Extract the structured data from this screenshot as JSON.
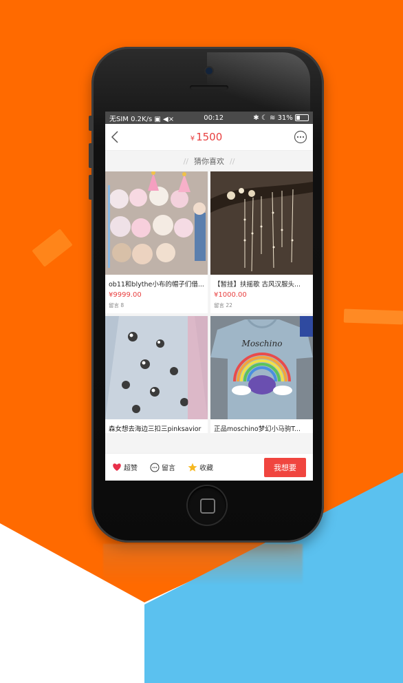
{
  "status_bar": {
    "carrier": "无SIM",
    "speed": "0.2K/s",
    "time": "00:12",
    "battery": "31%"
  },
  "nav": {
    "currency": "¥",
    "price": "1500"
  },
  "section": {
    "title": "猜你喜欢",
    "left_mark": "//",
    "right_mark": "//"
  },
  "products": [
    {
      "title": "ob11和blythe小布的帽子们借...",
      "price": "¥9999.00",
      "comments": "留言 8"
    },
    {
      "title": "【暂挂】扶摇歌 古风汉服头...",
      "price": "¥1000.00",
      "comments": "留言 22"
    },
    {
      "title": "森女想去海边三扣三pinksavior",
      "price": "",
      "comments": ""
    },
    {
      "title": "正品moschino梦幻小马驹T...",
      "price": "",
      "comments": ""
    }
  ],
  "shirt_print": "Moschino",
  "actions": {
    "like": "超赞",
    "comment": "留言",
    "favorite": "收藏",
    "want": "我想要"
  },
  "colors": {
    "orange_bg": "#ff6a00",
    "blue_bg": "#5bc1ef",
    "accent_red": "#e84040",
    "button_red": "#f0453f"
  }
}
